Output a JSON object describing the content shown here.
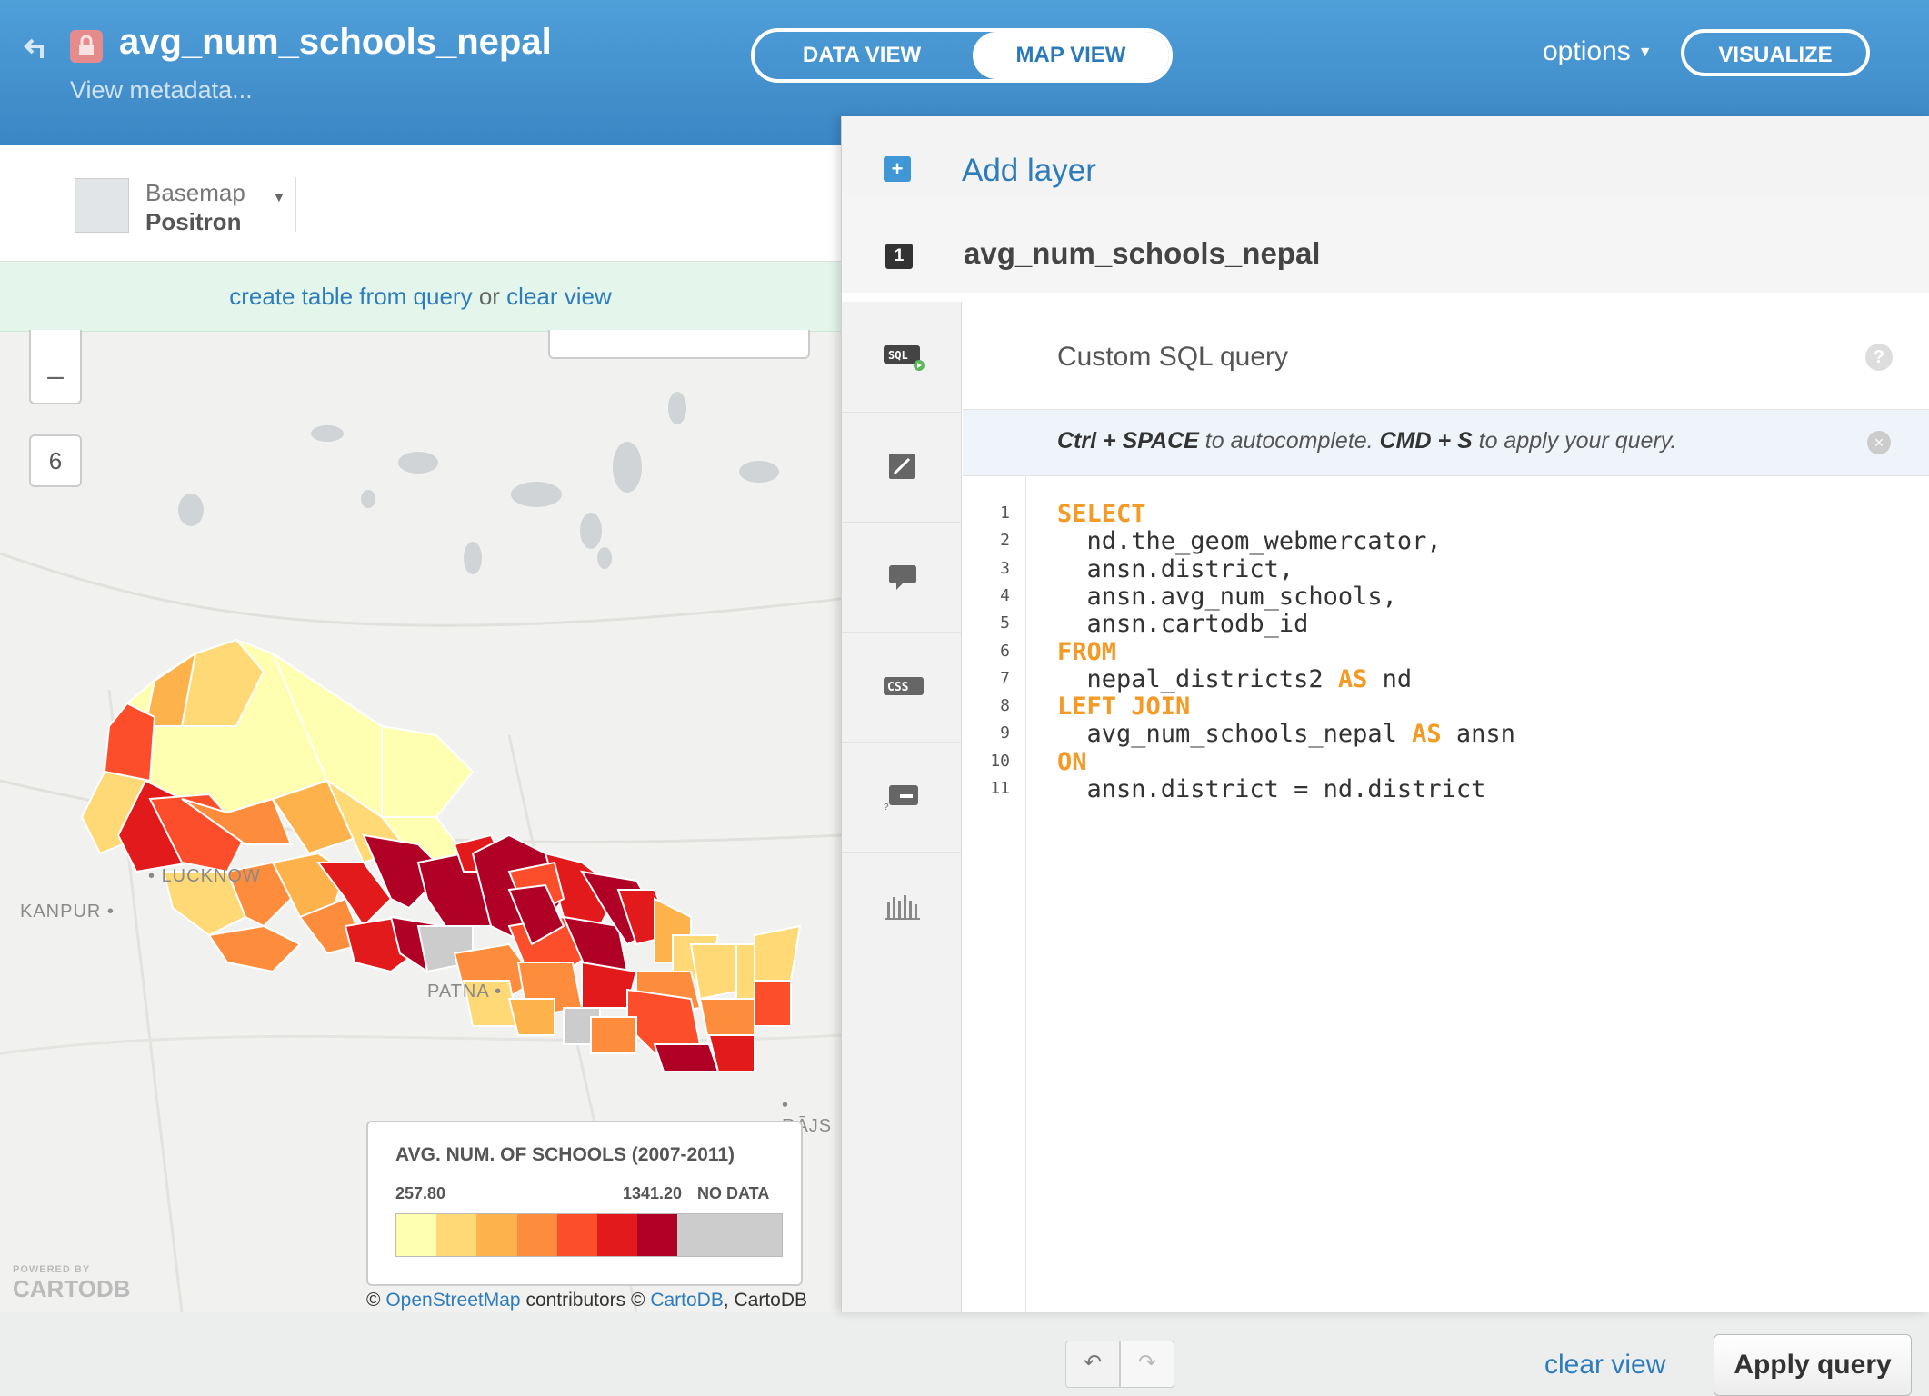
{
  "header": {
    "title": "avg_num_schools_nepal",
    "metadata_link": "View metadata...",
    "view_toggle": {
      "data_view": "DATA VIEW",
      "map_view": "MAP VIEW",
      "active": "MAP VIEW"
    },
    "options": "options",
    "visualize": "VISUALIZE"
  },
  "map": {
    "basemap": {
      "label": "Basemap",
      "name": "Positron"
    },
    "query_bar": {
      "create": "create table from query",
      "or": "or",
      "clear": "clear view"
    },
    "zoom": {
      "out": "–",
      "level": "6"
    },
    "cities": [
      {
        "name": "LUCKNOW"
      },
      {
        "name": "KANPUR"
      },
      {
        "name": "PATNA"
      },
      {
        "name": "RĀJS"
      }
    ],
    "legend": {
      "title": "AVG. NUM. OF SCHOOLS (2007-2011)",
      "min": "257.80",
      "max": "1341.20",
      "no_data": "NO DATA",
      "colors": [
        "#ffffb2",
        "#fed976",
        "#feb24c",
        "#fd8d3c",
        "#fc4e2a",
        "#e31a1c",
        "#b10026",
        "#cccccc"
      ]
    },
    "branding": {
      "powered": "POWERED BY",
      "name": "CARTODB"
    },
    "attribution": {
      "c1": "©",
      "osm": "OpenStreetMap",
      "contrib": "contributors ©",
      "cartodb": "CartoDB",
      "tail": ", CartoDB"
    }
  },
  "panel": {
    "add_layer": "Add layer",
    "layer_number": "1",
    "layer_name": "avg_num_schools_nepal",
    "tabs": [
      {
        "icon": "sql-icon"
      },
      {
        "icon": "wizard-icon"
      },
      {
        "icon": "infowindow-icon"
      },
      {
        "icon": "css-icon"
      },
      {
        "icon": "legend-icon"
      },
      {
        "icon": "filters-icon"
      }
    ],
    "editor": {
      "title": "Custom SQL query",
      "help": "?",
      "hint": {
        "k1": "Ctrl + SPACE",
        "t1": "to autocomplete.",
        "k2": "CMD + S",
        "t2": "to apply your query."
      },
      "lines": [
        {
          "n": "1",
          "kw": "SELECT",
          "text": "",
          "kw2": "",
          "text2": ""
        },
        {
          "n": "2",
          "kw": "",
          "text": "  nd.the_geom_webmercator,",
          "kw2": "",
          "text2": ""
        },
        {
          "n": "3",
          "kw": "",
          "text": "  ansn.district,",
          "kw2": "",
          "text2": ""
        },
        {
          "n": "4",
          "kw": "",
          "text": "  ansn.avg_num_schools,",
          "kw2": "",
          "text2": ""
        },
        {
          "n": "5",
          "kw": "",
          "text": "  ansn.cartodb_id",
          "kw2": "",
          "text2": ""
        },
        {
          "n": "6",
          "kw": "FROM",
          "text": "",
          "kw2": "",
          "text2": ""
        },
        {
          "n": "7",
          "kw": "",
          "text": "  nepal_districts2 ",
          "kw2": "AS",
          "text2": " nd"
        },
        {
          "n": "8",
          "kw": "LEFT JOIN",
          "text": "",
          "kw2": "",
          "text2": ""
        },
        {
          "n": "9",
          "kw": "",
          "text": "  avg_num_schools_nepal ",
          "kw2": "AS",
          "text2": " ansn"
        },
        {
          "n": "10",
          "kw": "ON",
          "text": "",
          "kw2": "",
          "text2": ""
        },
        {
          "n": "11",
          "kw": "",
          "text": "  ansn.district = nd.district",
          "kw2": "",
          "text2": ""
        }
      ],
      "clear_view": "clear view",
      "apply": "Apply query"
    }
  }
}
